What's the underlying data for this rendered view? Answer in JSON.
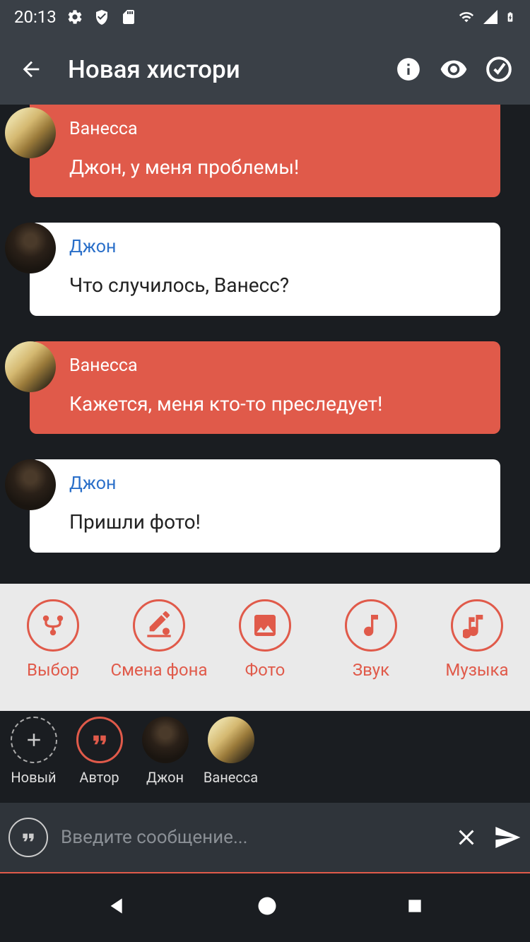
{
  "status": {
    "time": "20:13"
  },
  "header": {
    "title": "Новая хистори"
  },
  "messages": [
    {
      "sender": "Ванесса",
      "text": "Джон, у меня проблемы!",
      "theme": "red",
      "avatar": "vanessa"
    },
    {
      "sender": "Джон",
      "text": "Что случилось, Ванесс?",
      "theme": "white",
      "avatar": "john"
    },
    {
      "sender": "Ванесса",
      "text": "Кажется, меня кто-то преследует!",
      "theme": "red",
      "avatar": "vanessa"
    },
    {
      "sender": "Джон",
      "text": "Пришли фото!",
      "theme": "white",
      "avatar": "john"
    }
  ],
  "action_strip": [
    {
      "label": "Выбор",
      "icon": "branch"
    },
    {
      "label": "Смена фона",
      "icon": "paint"
    },
    {
      "label": "Фото",
      "icon": "photo"
    },
    {
      "label": "Звук",
      "icon": "note"
    },
    {
      "label": "Музыка",
      "icon": "music"
    }
  ],
  "characters": [
    {
      "label": "Новый",
      "type": "new"
    },
    {
      "label": "Автор",
      "type": "author"
    },
    {
      "label": "Джон",
      "type": "john"
    },
    {
      "label": "Ванесса",
      "type": "vanessa"
    }
  ],
  "input": {
    "placeholder": "Введите сообщение..."
  }
}
